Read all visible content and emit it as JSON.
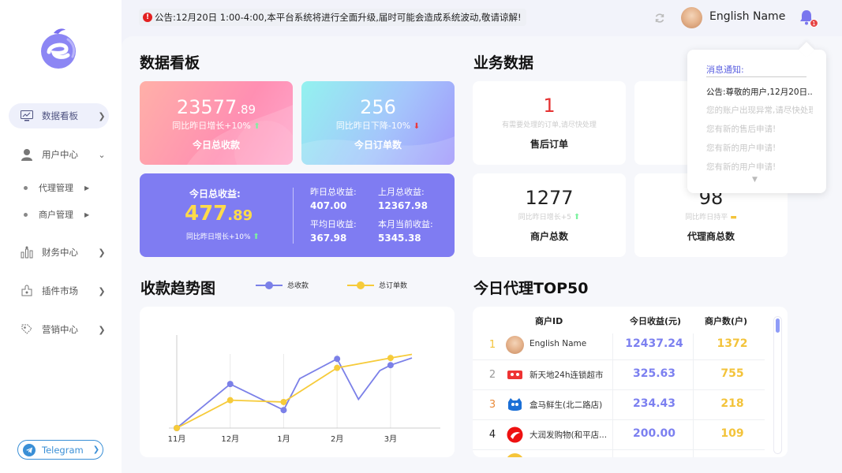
{
  "header": {
    "notice": "公告:12月20日 1:00-4:00,本平台系统将进行全面升级,届时可能会造成系统波动,敬请谅解!",
    "username": "English Name",
    "bell_badge": "1"
  },
  "sidebar": {
    "items": [
      {
        "label": "数据看板",
        "icon": "dashboard-icon"
      },
      {
        "label": "用户中心",
        "icon": "user-icon"
      },
      {
        "label": "财务中心",
        "icon": "finance-icon"
      },
      {
        "label": "插件市场",
        "icon": "plugin-icon"
      },
      {
        "label": "营销中心",
        "icon": "marketing-icon"
      }
    ],
    "sub_items": [
      "代理管理",
      "商户管理"
    ],
    "telegram": "Telegram"
  },
  "dashboard": {
    "title": "数据看板",
    "collection": {
      "int": "23577",
      "dec": ".89",
      "compare": "同比昨日增长+10%",
      "label": "今日总收款"
    },
    "orders": {
      "value": "256",
      "compare": "同比昨日下降-10%",
      "label": "今日订单数"
    },
    "revenue": {
      "title": "今日总收益:",
      "int": "477",
      "dec": ".89",
      "compare": "同比昨日增长+10%",
      "cells": [
        {
          "label": "昨日总收益:",
          "value": "407.00"
        },
        {
          "label": "上月总收益:",
          "value": "12367.98"
        },
        {
          "label": "平均日收益:",
          "value": "367.98"
        },
        {
          "label": "本月当前收益:",
          "value": "5345.38"
        }
      ]
    }
  },
  "business": {
    "title": "业务数据",
    "after_sales": {
      "value": "1",
      "hint": "有需要处理的订单,请尽快处理",
      "label": "售后订单"
    },
    "merchants": {
      "value": "1277",
      "hint": "同比昨日增长+5",
      "label": "商户总数"
    },
    "agents": {
      "value": "98",
      "hint": "同比昨日持平",
      "label": "代理商总数"
    }
  },
  "notifications": {
    "title": "消息通知:",
    "items": [
      "公告:尊敬的用户,12月20日...",
      "您的账户出现异常,请尽快处理",
      "您有新的售后申请!",
      "您有新的用户申请!",
      "您有新的用户申请!"
    ],
    "more": "▼"
  },
  "trend": {
    "title": "收款趋势图",
    "legend": [
      "总收款",
      "总订单数"
    ]
  },
  "chart_data": {
    "type": "line",
    "categories": [
      "11月",
      "12月",
      "1月",
      "2月",
      "3月"
    ],
    "series": [
      {
        "name": "总收款",
        "x": [
          0,
          1,
          2,
          2.3,
          3,
          3.4,
          3.8,
          4,
          4.4
        ],
        "y": [
          0,
          49,
          20,
          55,
          77,
          32,
          64,
          70,
          78
        ],
        "color": "#7b80e8"
      },
      {
        "name": "总订单数",
        "x": [
          0,
          1,
          2,
          3,
          4,
          4.4
        ],
        "y": [
          0,
          31,
          29,
          67,
          78,
          82
        ],
        "color": "#f6cb3a"
      }
    ],
    "xlim": [
      0,
      4.4
    ],
    "ylim": [
      0,
      100
    ],
    "grid": "vertical"
  },
  "top50": {
    "title": "今日代理TOP50",
    "columns": [
      "商户ID",
      "今日收益(元)",
      "商户数(户)"
    ],
    "rows": [
      {
        "rank": "1",
        "name": "English Name",
        "revenue": "12437.24",
        "count": "1372",
        "rank_color": "#f3c33a",
        "icon": "user-avatar-icon"
      },
      {
        "rank": "2",
        "name": "新天地24h连锁超市",
        "revenue": "325.63",
        "count": "755",
        "rank_color": "#999999",
        "icon": "supermarket-logo-icon"
      },
      {
        "rank": "3",
        "name": "盒马鲜生(北二路店)",
        "revenue": "234.43",
        "count": "218",
        "rank_color": "#e98a3a",
        "icon": "hema-logo-icon"
      },
      {
        "rank": "4",
        "name": "大润发购物(和平店...",
        "revenue": "200.00",
        "count": "109",
        "rank_color": "#222222",
        "icon": "rtmart-logo-icon"
      }
    ]
  }
}
